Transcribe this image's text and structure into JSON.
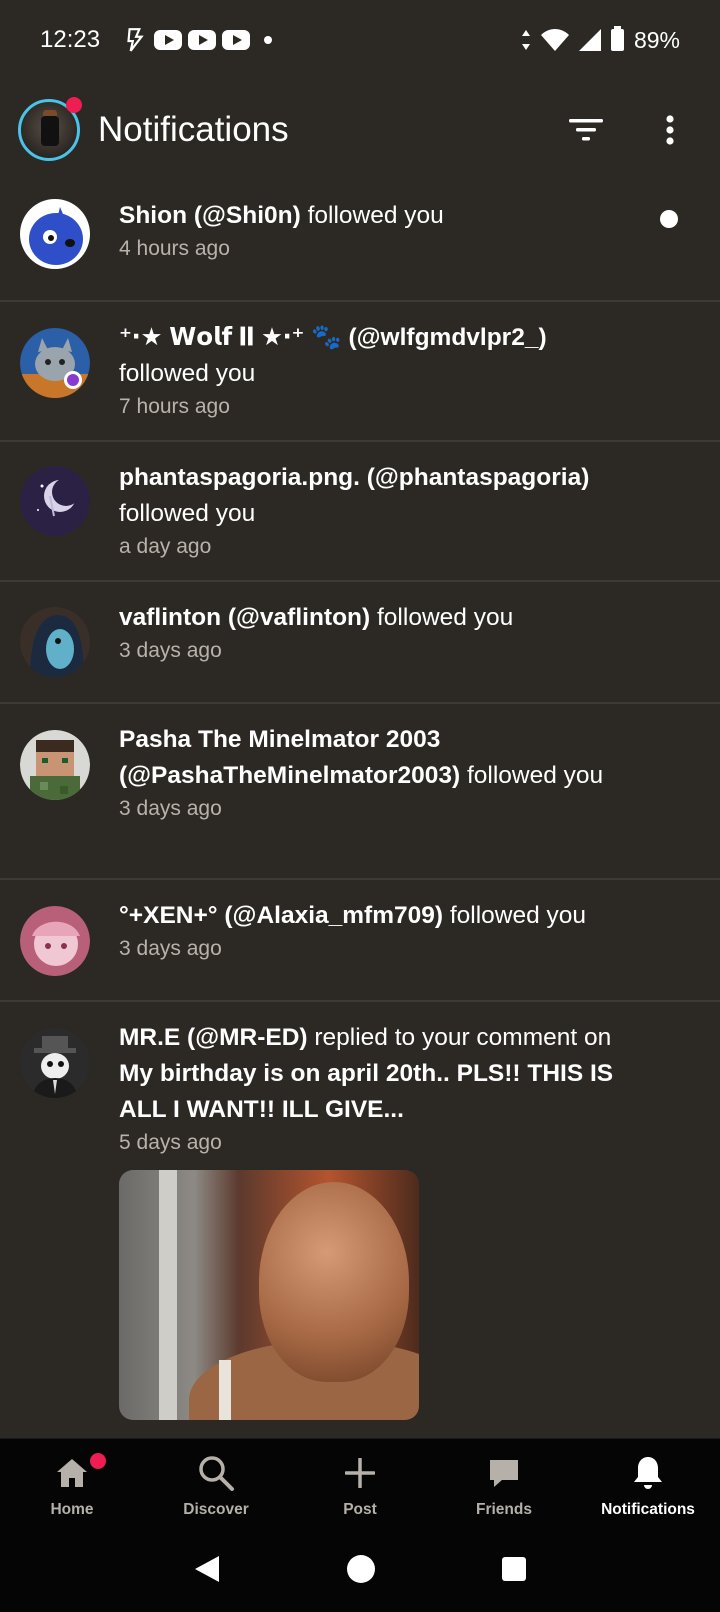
{
  "status_bar": {
    "time": "12:23",
    "battery": "89%"
  },
  "header": {
    "title": "Notifications",
    "filter_icon": "filter-icon",
    "more_icon": "more-vertical-icon"
  },
  "notifications": [
    {
      "name": "Shion (@Shi0n)",
      "action": "followed you",
      "time": "4 hours ago",
      "unread": true
    },
    {
      "name": "⁺‧★ 𝗪𝗼𝗹𝗳 𝐈𝐈 ★‧⁺ 🐾 (@wlfgmdvlpr2_)",
      "action": "followed you",
      "time": "7 hours ago"
    },
    {
      "name": "phantaspagoria.png. (@phantaspagoria)",
      "action": "followed you",
      "time": "a day ago"
    },
    {
      "name": "vaflinton (@vaflinton)",
      "action": "followed you",
      "time": "3 days ago"
    },
    {
      "name": "Pasha The Minelmator 2003 (@PashaTheMinelmator2003)",
      "action": "followed you",
      "time": "3 days ago"
    },
    {
      "name": "°+XEN+° (@Alaxia_mfm709)",
      "action": "followed you",
      "time": "3 days ago"
    },
    {
      "name": "MR.E (@MR-ED)",
      "action": "replied to your comment on",
      "post": "My birthday is on april 20th.. PLS!! THIS IS ALL I WANT!! ILL GIVE...",
      "time": "5 days ago"
    }
  ],
  "bottom_nav": {
    "items": [
      {
        "label": "Home"
      },
      {
        "label": "Discover"
      },
      {
        "label": "Post"
      },
      {
        "label": "Friends"
      },
      {
        "label": "Notifications"
      }
    ]
  },
  "colors": {
    "background": "#2c2925",
    "accent_badge": "#ee1d52",
    "avatar_ring": "#49c3e8"
  }
}
